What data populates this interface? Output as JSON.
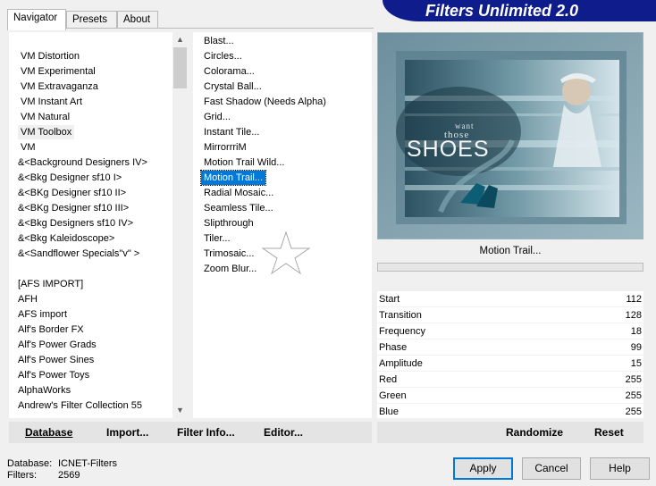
{
  "tabs": [
    "Navigator",
    "Presets",
    "About"
  ],
  "banner_title": "Filters Unlimited 2.0",
  "categories": [
    "VM Distortion",
    "VM Experimental",
    "VM Extravaganza",
    "VM Instant Art",
    "VM Natural",
    "VM Toolbox",
    "VM",
    "&<Background Designers IV>",
    "&<Bkg Designer sf10 I>",
    "&<BKg Designer sf10 II>",
    "&<BKg Designer sf10 III>",
    "&<Bkg Designers sf10 IV>",
    "&<Bkg Kaleidoscope>",
    "&<Sandflower Specials\"v\" >",
    "[AFS IMPORT]",
    "AFH",
    "AFS import",
    "Alf's Border FX",
    "Alf's Power Grads",
    "Alf's Power Sines",
    "Alf's Power Toys",
    "AlphaWorks",
    "Andrew's Filter Collection 55"
  ],
  "selected_category": "VM Toolbox",
  "filters": [
    "Blast...",
    "Circles...",
    "Colorama...",
    "Crystal Ball...",
    "Fast Shadow (Needs Alpha)",
    "Grid...",
    "Instant Tile...",
    "MirrorrriM",
    "Motion Trail Wild...",
    "Motion Trail...",
    "Radial Mosaic...",
    "Seamless Tile...",
    "Slipthrough",
    "Tiler...",
    "Trimosaic...",
    "Zoom Blur..."
  ],
  "selected_filter": "Motion Trail...",
  "preview": {
    "text_line1": "want",
    "text_line2": "those",
    "text_line3": "SHOES"
  },
  "current_filter_name": "Motion Trail...",
  "params": [
    {
      "label": "Start",
      "value": "112"
    },
    {
      "label": "Transition",
      "value": "128"
    },
    {
      "label": "Frequency",
      "value": "18"
    },
    {
      "label": "Phase",
      "value": "99"
    },
    {
      "label": "Amplitude",
      "value": "15"
    },
    {
      "label": "Red",
      "value": "255"
    },
    {
      "label": "Green",
      "value": "255"
    },
    {
      "label": "Blue",
      "value": "255"
    }
  ],
  "bottom_buttons": {
    "database": "Database",
    "import": "Import...",
    "filter_info": "Filter Info...",
    "editor": "Editor...",
    "randomize": "Randomize",
    "reset": "Reset"
  },
  "status": {
    "database_label": "Database:",
    "database_value": "ICNET-Filters",
    "filters_label": "Filters:",
    "filters_value": "2569"
  },
  "dialog_buttons": {
    "apply": "Apply",
    "cancel": "Cancel",
    "help": "Help"
  },
  "colors": {
    "banner": "#0f1d8c",
    "selection": "#0078d7"
  }
}
